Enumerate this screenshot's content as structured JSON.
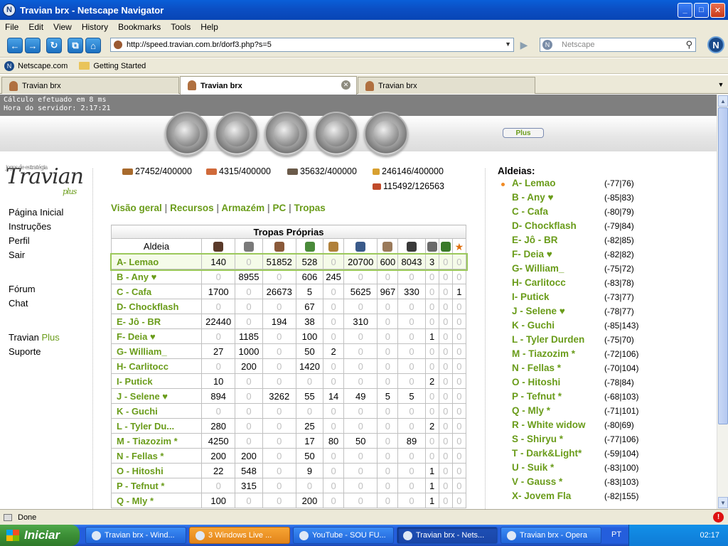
{
  "window": {
    "title": "Travian brx - Netscape Navigator",
    "min": "_",
    "max": "□",
    "close": "✕",
    "app_icon": "N"
  },
  "menu": [
    "File",
    "Edit",
    "View",
    "History",
    "Bookmarks",
    "Tools",
    "Help"
  ],
  "toolbar": {
    "url": "http://speed.travian.com.br/dorf3.php?s=5",
    "search_placeholder": "Netscape",
    "back": "←",
    "forward": "→",
    "reload": "↻",
    "home": "⌂",
    "go": "▶",
    "logo": "N"
  },
  "bookmarks": [
    {
      "label": "Netscape.com",
      "icon": "netscape-icon"
    },
    {
      "label": "Getting Started",
      "icon": "folder-icon"
    }
  ],
  "tabs": [
    {
      "label": "Travian brx",
      "active": false
    },
    {
      "label": "Travian brx",
      "active": true
    },
    {
      "label": "Travian brx",
      "active": false
    }
  ],
  "calc": {
    "line1": "Cálculo efetuado em 8 ms",
    "line2": "Hora do servidor: 2:17:21"
  },
  "plus_button": "Plus",
  "left_nav": {
    "logo_small": "jogos de estratégia",
    "logo": "Travian",
    "logo_plus": "plus",
    "items1": [
      "Página Inicial",
      "Instruções",
      "Perfil",
      "Sair"
    ],
    "items2": [
      "Fórum",
      "Chat"
    ],
    "travian": "Travian",
    "plus": "Plus",
    "suporte": "Suporte"
  },
  "resources": {
    "wood": "27452/400000",
    "clay": "4315/400000",
    "iron": "35632/400000",
    "crop": "246146/400000",
    "consumption": "115492/126563"
  },
  "subnav": [
    "Visão geral",
    "Recursos",
    "Armazém",
    "PC",
    "Tropas"
  ],
  "troops": {
    "title": "Tropas Próprias",
    "col_aldeia": "Aldeia",
    "unit_icons": [
      "clubswinger-icon",
      "spearman-icon",
      "axeman-icon",
      "scout-icon",
      "paladin-icon",
      "teutonic-knight-icon",
      "ram-icon",
      "catapult-icon",
      "chief-icon",
      "settler-icon",
      "hero-icon"
    ],
    "rows": [
      {
        "name": "A- Lemao",
        "v": [
          "140",
          "0",
          "51852",
          "528",
          "0",
          "20700",
          "600",
          "8043",
          "3",
          "0",
          "0"
        ],
        "current": true
      },
      {
        "name": "B - Any ♥",
        "v": [
          "0",
          "8955",
          "0",
          "606",
          "245",
          "0",
          "0",
          "0",
          "0",
          "0",
          "0"
        ]
      },
      {
        "name": "C - Cafa",
        "v": [
          "1700",
          "0",
          "26673",
          "5",
          "0",
          "5625",
          "967",
          "330",
          "0",
          "0",
          "1"
        ]
      },
      {
        "name": "D- Chockflash",
        "v": [
          "0",
          "0",
          "0",
          "67",
          "0",
          "0",
          "0",
          "0",
          "0",
          "0",
          "0"
        ]
      },
      {
        "name": "E- Jô - BR",
        "v": [
          "22440",
          "0",
          "194",
          "38",
          "0",
          "310",
          "0",
          "0",
          "0",
          "0",
          "0"
        ]
      },
      {
        "name": "F- Deia ♥",
        "v": [
          "0",
          "1185",
          "0",
          "100",
          "0",
          "0",
          "0",
          "0",
          "1",
          "0",
          "0"
        ]
      },
      {
        "name": "G- William_",
        "v": [
          "27",
          "1000",
          "0",
          "50",
          "2",
          "0",
          "0",
          "0",
          "0",
          "0",
          "0"
        ]
      },
      {
        "name": "H- Carlitocc",
        "v": [
          "0",
          "200",
          "0",
          "1420",
          "0",
          "0",
          "0",
          "0",
          "0",
          "0",
          "0"
        ]
      },
      {
        "name": "I- Putick",
        "v": [
          "10",
          "0",
          "0",
          "0",
          "0",
          "0",
          "0",
          "0",
          "2",
          "0",
          "0"
        ]
      },
      {
        "name": "J - Selene ♥",
        "v": [
          "894",
          "0",
          "3262",
          "55",
          "14",
          "49",
          "5",
          "5",
          "0",
          "0",
          "0"
        ]
      },
      {
        "name": "K - Guchi",
        "v": [
          "0",
          "0",
          "0",
          "0",
          "0",
          "0",
          "0",
          "0",
          "0",
          "0",
          "0"
        ]
      },
      {
        "name": "L - Tyler Du...",
        "v": [
          "280",
          "0",
          "0",
          "25",
          "0",
          "0",
          "0",
          "0",
          "2",
          "0",
          "0"
        ]
      },
      {
        "name": "M - Tiazozim *",
        "v": [
          "4250",
          "0",
          "0",
          "17",
          "80",
          "50",
          "0",
          "89",
          "0",
          "0",
          "0"
        ]
      },
      {
        "name": "N - Fellas *",
        "v": [
          "200",
          "200",
          "0",
          "50",
          "0",
          "0",
          "0",
          "0",
          "0",
          "0",
          "0"
        ]
      },
      {
        "name": "O - Hitoshi",
        "v": [
          "22",
          "548",
          "0",
          "9",
          "0",
          "0",
          "0",
          "0",
          "1",
          "0",
          "0"
        ]
      },
      {
        "name": "P - Tefnut *",
        "v": [
          "0",
          "315",
          "0",
          "0",
          "0",
          "0",
          "0",
          "0",
          "1",
          "0",
          "0"
        ]
      },
      {
        "name": "Q - Mly *",
        "v": [
          "100",
          "0",
          "0",
          "200",
          "0",
          "0",
          "0",
          "0",
          "1",
          "0",
          "0"
        ]
      }
    ]
  },
  "villages": {
    "title": "Aldeias:",
    "list": [
      {
        "name": "A- Lemao",
        "coords": "(-77|76)"
      },
      {
        "name": "B - Any ♥",
        "coords": "(-85|83)"
      },
      {
        "name": "C - Cafa",
        "coords": "(-80|79)"
      },
      {
        "name": "D- Chockflash",
        "coords": "(-79|84)"
      },
      {
        "name": "E- Jô - BR",
        "coords": "(-82|85)"
      },
      {
        "name": "F- Deia ♥",
        "coords": "(-82|82)"
      },
      {
        "name": "G- William_",
        "coords": "(-75|72)"
      },
      {
        "name": "H- Carlitocc",
        "coords": "(-83|78)"
      },
      {
        "name": "I- Putick",
        "coords": "(-73|77)"
      },
      {
        "name": "J - Selene ♥",
        "coords": "(-78|77)"
      },
      {
        "name": "K - Guchi",
        "coords": "(-85|143)"
      },
      {
        "name": "L - Tyler Durden",
        "coords": "(-75|70)"
      },
      {
        "name": "M - Tiazozim *",
        "coords": "(-72|106)"
      },
      {
        "name": "N - Fellas *",
        "coords": "(-70|104)"
      },
      {
        "name": "O - Hitoshi",
        "coords": "(-78|84)"
      },
      {
        "name": "P - Tefnut *",
        "coords": "(-68|103)"
      },
      {
        "name": "Q - Mly *",
        "coords": "(-71|101)"
      },
      {
        "name": "R - White widow",
        "coords": "(-80|69)"
      },
      {
        "name": "S - Shiryu *",
        "coords": "(-77|106)"
      },
      {
        "name": "T - Dark&Light*",
        "coords": "(-59|104)"
      },
      {
        "name": "U - Suik *",
        "coords": "(-83|100)"
      },
      {
        "name": "V - Gauss *",
        "coords": "(-83|103)"
      },
      {
        "name": "X- Jovem Fla",
        "coords": "(-82|155)"
      }
    ]
  },
  "status": {
    "text": "Done",
    "error_icon": "!"
  },
  "taskbar": {
    "start": "Iniciar",
    "items": [
      {
        "label": "Travian brx - Wind...",
        "state": "normal"
      },
      {
        "label": "3 Windows Live ...",
        "state": "orange"
      },
      {
        "label": "YouTube - SOU FU...",
        "state": "normal"
      },
      {
        "label": "Travian brx - Nets...",
        "state": "active"
      },
      {
        "label": "Travian brx - Opera",
        "state": "normal"
      }
    ],
    "lang": "PT",
    "clock": "02:17"
  },
  "colors": {
    "accent_green": "#6a9c1a",
    "title_blue": "#0b4fc4",
    "calc_gray": "#7f7f7f",
    "zero_gray": "#c0c0c0"
  }
}
